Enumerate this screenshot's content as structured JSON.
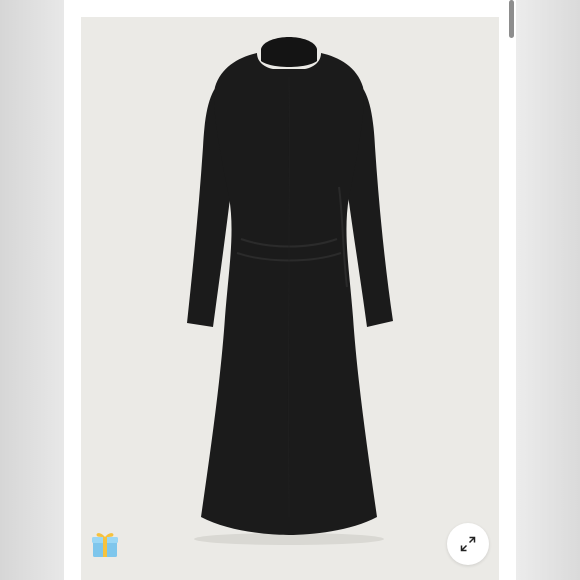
{
  "product_image": {
    "subject": "dress-black-long-sleeve-midi",
    "dress_color": "#1b1b1b",
    "backdrop_color": "#ebeae6"
  },
  "badges": {
    "gift_icon": "gift-icon"
  },
  "controls": {
    "zoom_icon": "expand-arrows-icon"
  }
}
